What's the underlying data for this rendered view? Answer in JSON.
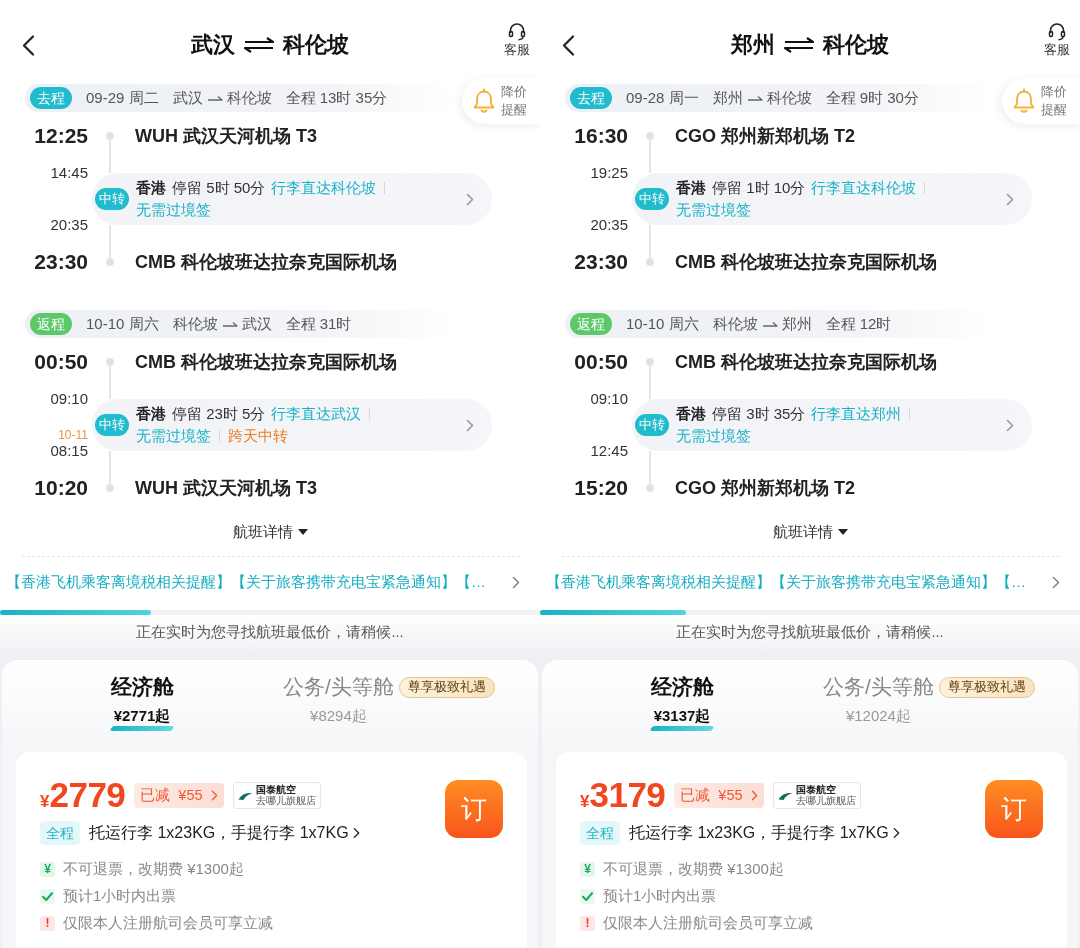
{
  "panels": [
    {
      "header": {
        "origin": "武汉",
        "destination": "科伦坡",
        "service_label": "客服"
      },
      "price_alert": {
        "label": "降价提醒"
      },
      "legs": [
        {
          "kind": "outbound",
          "tag": "去程",
          "date": "09-29 周二",
          "from": "武汉",
          "to": "科伦坡",
          "duration": "全程 13时 35分",
          "departure": {
            "time": "12:25",
            "airport": "WUH 武汉天河机场 T3"
          },
          "transfer": {
            "tag": "中转",
            "arrive_time": "14:45",
            "depart_time": "20:35",
            "city": "香港",
            "stay": "停留 5时 50分",
            "notes": [
              {
                "kind": "info",
                "text": "行李直达科伦坡"
              },
              {
                "kind": "info",
                "text": "无需过境签"
              }
            ]
          },
          "arrival": {
            "time": "23:30",
            "airport": "CMB 科伦坡班达拉奈克国际机场"
          }
        },
        {
          "kind": "return",
          "tag": "返程",
          "date": "10-10 周六",
          "from": "科伦坡",
          "to": "武汉",
          "duration": "全程 31时",
          "departure": {
            "time": "00:50",
            "airport": "CMB 科伦坡班达拉奈克国际机场"
          },
          "transfer": {
            "tag": "中转",
            "arrive_time": "09:10",
            "depart_date": "10-11",
            "depart_time": "08:15",
            "city": "香港",
            "stay": "停留 23时 5分",
            "notes": [
              {
                "kind": "info",
                "text": "行李直达武汉"
              },
              {
                "kind": "info",
                "text": "无需过境签"
              },
              {
                "kind": "warning",
                "text": "跨天中转"
              }
            ]
          },
          "arrival": {
            "time": "10:20",
            "airport": "WUH 武汉天河机场 T3"
          }
        }
      ],
      "details_link": "航班详情",
      "notice": "【香港飞机乘客离境税相关提醒】【关于旅客携带充电宝紧急通知】【…",
      "search_progress": {
        "level": 0.28,
        "message": "正在实时为您寻找航班最低价，请稍候..."
      },
      "cabin_tabs": [
        {
          "label": "经济舱",
          "price": "¥2771起",
          "selected": true
        },
        {
          "label": "公务/头等舱",
          "price": "¥8294起",
          "selected": false,
          "badge": "尊享极致礼遇"
        }
      ],
      "fare": {
        "currency": "¥",
        "price": "2779",
        "discount": {
          "label": "已减",
          "amount": "¥55"
        },
        "airline": {
          "name": "国泰航空",
          "store": "去哪儿旗舰店"
        },
        "book_label": "订",
        "baggage": {
          "tag": "全程",
          "text": "托运行李 1x23KG，手提行李 1x7KG"
        },
        "policies": [
          {
            "kind": "fee",
            "symbol": "¥",
            "text": "不可退票，改期费 ¥1300起"
          },
          {
            "kind": "check",
            "text": "预计1小时内出票"
          },
          {
            "kind": "notice",
            "symbol": "!",
            "text": "仅限本人注册航司会员可享立减"
          }
        ]
      }
    },
    {
      "header": {
        "origin": "郑州",
        "destination": "科伦坡",
        "service_label": "客服"
      },
      "price_alert": {
        "label": "降价提醒"
      },
      "legs": [
        {
          "kind": "outbound",
          "tag": "去程",
          "date": "09-28 周一",
          "from": "郑州",
          "to": "科伦坡",
          "duration": "全程 9时 30分",
          "departure": {
            "time": "16:30",
            "airport": "CGO 郑州新郑机场 T2"
          },
          "transfer": {
            "tag": "中转",
            "arrive_time": "19:25",
            "depart_time": "20:35",
            "city": "香港",
            "stay": "停留 1时 10分",
            "notes": [
              {
                "kind": "info",
                "text": "行李直达科伦坡"
              },
              {
                "kind": "info",
                "text": "无需过境签"
              }
            ]
          },
          "arrival": {
            "time": "23:30",
            "airport": "CMB 科伦坡班达拉奈克国际机场"
          }
        },
        {
          "kind": "return",
          "tag": "返程",
          "date": "10-10 周六",
          "from": "科伦坡",
          "to": "郑州",
          "duration": "全程 12时",
          "departure": {
            "time": "00:50",
            "airport": "CMB 科伦坡班达拉奈克国际机场"
          },
          "transfer": {
            "tag": "中转",
            "arrive_time": "09:10",
            "depart_time": "12:45",
            "city": "香港",
            "stay": "停留 3时 35分",
            "notes": [
              {
                "kind": "info",
                "text": "行李直达郑州"
              },
              {
                "kind": "info",
                "text": "无需过境签"
              }
            ]
          },
          "arrival": {
            "time": "15:20",
            "airport": "CGO 郑州新郑机场 T2"
          }
        }
      ],
      "details_link": "航班详情",
      "notice": "【香港飞机乘客离境税相关提醒】【关于旅客携带充电宝紧急通知】【…",
      "search_progress": {
        "level": 0.27,
        "message": "正在实时为您寻找航班最低价，请稍候..."
      },
      "cabin_tabs": [
        {
          "label": "经济舱",
          "price": "¥3137起",
          "selected": true
        },
        {
          "label": "公务/头等舱",
          "price": "¥12024起",
          "selected": false,
          "badge": "尊享极致礼遇"
        }
      ],
      "fare": {
        "currency": "¥",
        "price": "3179",
        "discount": {
          "label": "已减",
          "amount": "¥55"
        },
        "airline": {
          "name": "国泰航空",
          "store": "去哪儿旗舰店"
        },
        "book_label": "订",
        "baggage": {
          "tag": "全程",
          "text": "托运行李 1x23KG，手提行李 1x7KG"
        },
        "policies": [
          {
            "kind": "fee",
            "symbol": "¥",
            "text": "不可退票，改期费 ¥1300起"
          },
          {
            "kind": "check",
            "text": "预计1小时内出票"
          },
          {
            "kind": "notice",
            "symbol": "!",
            "text": "仅限本人注册航司会员可享立减"
          }
        ]
      }
    }
  ]
}
